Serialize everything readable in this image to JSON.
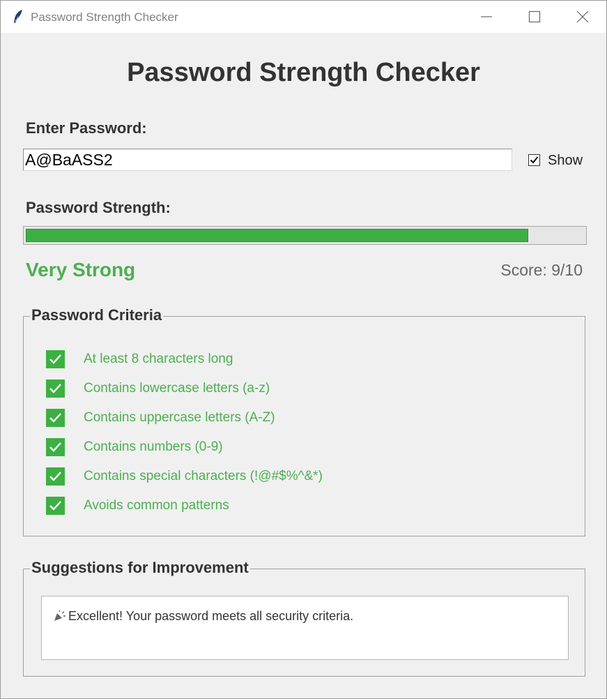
{
  "window": {
    "title": "Password Strength Checker",
    "icon": "feather-icon"
  },
  "heading": "Password Strength Checker",
  "password_section": {
    "label": "Enter Password:",
    "value": "A@BaASS2",
    "show_checked": true,
    "show_label": "Show"
  },
  "strength_section": {
    "label": "Password Strength:",
    "progress_fraction": 0.9,
    "rating": "Very Strong",
    "rating_color": "#4caf50",
    "score": "Score: 9/10"
  },
  "criteria": {
    "title": "Password Criteria",
    "text_color": "#4caf50",
    "check_color": "#3cb043",
    "items": [
      {
        "label": "At least 8 characters long",
        "met": true
      },
      {
        "label": "Contains lowercase letters (a-z)",
        "met": true
      },
      {
        "label": "Contains uppercase letters (A-Z)",
        "met": true
      },
      {
        "label": "Contains numbers (0-9)",
        "met": true
      },
      {
        "label": "Contains special characters (!@#$%^&*)",
        "met": true
      },
      {
        "label": "Avoids common patterns",
        "met": true
      }
    ]
  },
  "suggestions": {
    "title": "Suggestions for Improvement",
    "icon": "party-popper-icon",
    "text": "Excellent! Your password meets all security criteria."
  }
}
